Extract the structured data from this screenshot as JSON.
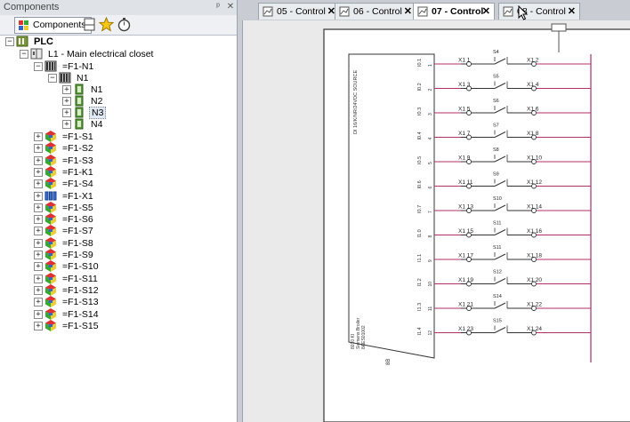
{
  "panel": {
    "title": "Components",
    "pin_glyph": "ᵖ",
    "close_glyph": "✕",
    "toolbar": {
      "components_label": "Components",
      "icons": [
        "components-icon",
        "page-icon",
        "star-icon",
        "timer-icon"
      ]
    }
  },
  "tree": {
    "root": "PLC",
    "location": "L1 - Main electrical closet",
    "plc_device": "=F1-N1",
    "rack": "N1",
    "modules": [
      "N1",
      "N2",
      "N3",
      "N4"
    ],
    "selected_module": "N3",
    "devices": [
      "=F1-S1",
      "=F1-S2",
      "=F1-S3",
      "=F1-K1",
      "=F1-S4",
      "=F1-X1",
      "=F1-S5",
      "=F1-S6",
      "=F1-S7",
      "=F1-S8",
      "=F1-S9",
      "=F1-S10",
      "=F1-S11",
      "=F1-S12",
      "=F1-S13",
      "=F1-S14",
      "=F1-S15"
    ]
  },
  "tabs": [
    {
      "label": "05 - Control",
      "active": false
    },
    {
      "label": "06 - Control",
      "active": false
    },
    {
      "label": "07 - Control",
      "active": true
    },
    {
      "label": "08 - Control",
      "active": false
    }
  ],
  "schematic": {
    "module_text": [
      "DI 16/K/NR/24VDC SOURCE"
    ],
    "module_bottom_text": [
      "8010 KI",
      "Siemens Broiler",
      "8AES01002"
    ],
    "module_ref": "8B",
    "channels": [
      {
        "pin": "I0.1",
        "num": "1",
        "switch": "S4",
        "x1a": "X1 1",
        "x1b": "X1 2"
      },
      {
        "pin": "I0.2",
        "num": "2",
        "switch": "S5",
        "x1a": "X1 3",
        "x1b": "X1 4"
      },
      {
        "pin": "I0.3",
        "num": "3",
        "switch": "S6",
        "x1a": "X1 5",
        "x1b": "X1 6"
      },
      {
        "pin": "I0.4",
        "num": "4",
        "switch": "S7",
        "x1a": "X1 7",
        "x1b": "X1 8"
      },
      {
        "pin": "I0.5",
        "num": "5",
        "switch": "S8",
        "x1a": "X1 9",
        "x1b": "X1 10"
      },
      {
        "pin": "I0.6",
        "num": "6",
        "switch": "S9",
        "x1a": "X1 11",
        "x1b": "X1 12"
      },
      {
        "pin": "I0.7",
        "num": "7",
        "switch": "S10",
        "x1a": "X1 13",
        "x1b": "X1 14"
      },
      {
        "pin": "I1.0",
        "num": "8",
        "switch": "S11",
        "x1a": "X1 15",
        "x1b": "X1 16"
      },
      {
        "pin": "I1.1",
        "num": "9",
        "switch": "S11",
        "x1a": "X1 17",
        "x1b": "X1 18"
      },
      {
        "pin": "I1.2",
        "num": "10",
        "switch": "S12",
        "x1a": "X1 19",
        "x1b": "X1 20"
      },
      {
        "pin": "I1.3",
        "num": "11",
        "switch": "S14",
        "x1a": "X1 21",
        "x1b": "X1 22"
      },
      {
        "pin": "I1.4",
        "num": "12",
        "switch": "S15",
        "x1a": "X1 23",
        "x1b": "X1 24"
      }
    ]
  },
  "colors": {
    "wire": "#b0306a",
    "line": "#333333",
    "selection": "#dfe8f3"
  }
}
